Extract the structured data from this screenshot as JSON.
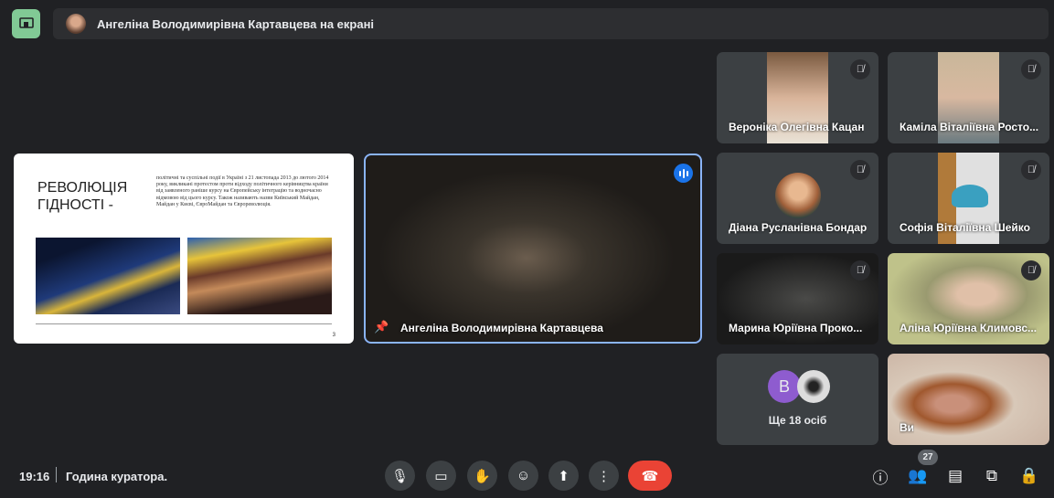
{
  "banner": {
    "text": "Ангеліна Володимирівна Картавцева на екрані"
  },
  "slide": {
    "title": "РЕВОЛЮЦІЯ ГІДНОСТІ -",
    "body": "політичні та суспільні події в Україні з 21 листопада 2013 до лютого 2014 року, викликані протестом проти відходу політичного керівництва країни від заявленого раніше курсу на Європейську інтеграцію та водночасно відмовою від цього курсу. Також називають назви Київський Майдан, Майдан у Києві, ЄвроМайдан та Євроревoлюція.",
    "page": "3"
  },
  "main_video": {
    "name": "Ангеліна Володимирівна Картавцева"
  },
  "participants": [
    {
      "name": "Вероніка Олегівна Кацан"
    },
    {
      "name": "Каміла Віталіївна Росто..."
    },
    {
      "name": "Діана Русланівна Бондар"
    },
    {
      "name": "Софія Віталіївна Шейко"
    },
    {
      "name": "Марина Юріївна Проко..."
    },
    {
      "name": "Аліна Юріївна Климовс..."
    },
    {
      "name": "Ще 18 осіб",
      "avatar_letter": "В"
    },
    {
      "name": "Ви"
    }
  ],
  "bottom": {
    "time": "19:16",
    "meeting": "Година куратора.",
    "participants_count": "27"
  },
  "colors": {
    "accent": "#8ab4f8",
    "end_call": "#ea4335",
    "present": "#81c995"
  }
}
